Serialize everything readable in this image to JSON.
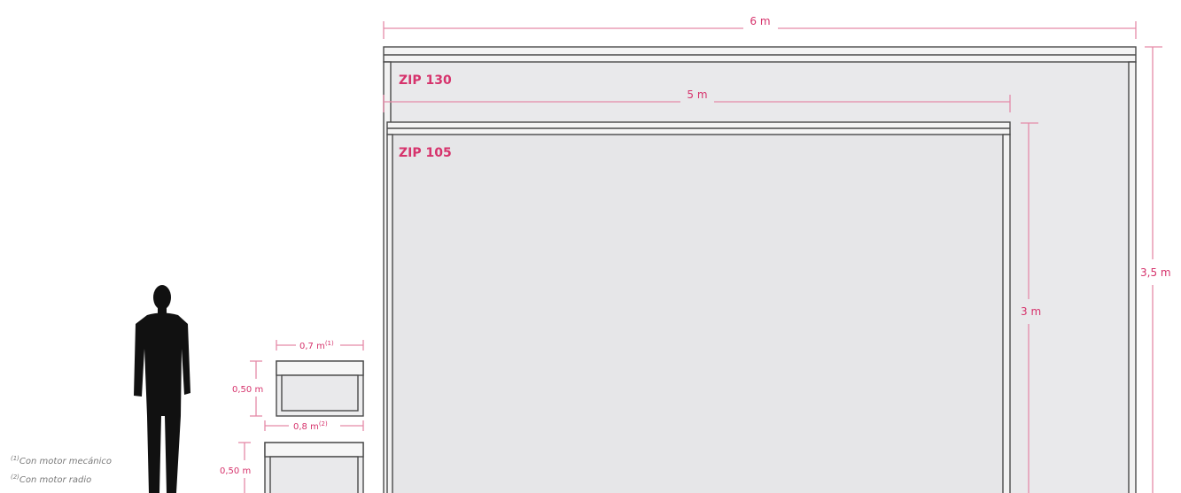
{
  "diagram": {
    "dim_6m": "6 m",
    "dim_5m": "5 m",
    "dim_3_5m": "3,5 m",
    "dim_3m": "3 m",
    "zip130": "ZIP 130",
    "zip105": "ZIP 105",
    "box_small": {
      "width_label": "0,7 m",
      "width_sup": "(1)",
      "height_label": "0,50 m"
    },
    "box_large": {
      "width_label": "0,8 m",
      "width_sup": "(2)",
      "height_label": "0,50 m"
    },
    "notes": [
      {
        "sup": "(1)",
        "text": "Con motor mecánico"
      },
      {
        "sup": "(2)",
        "text": "Con motor radio"
      }
    ]
  },
  "colors": {
    "accent": "#d6336c",
    "dimension_line": "#e58aa8",
    "frame": "#4a4a4a",
    "screen_fill": "#e9e9eb",
    "silhouette": "#111111"
  }
}
